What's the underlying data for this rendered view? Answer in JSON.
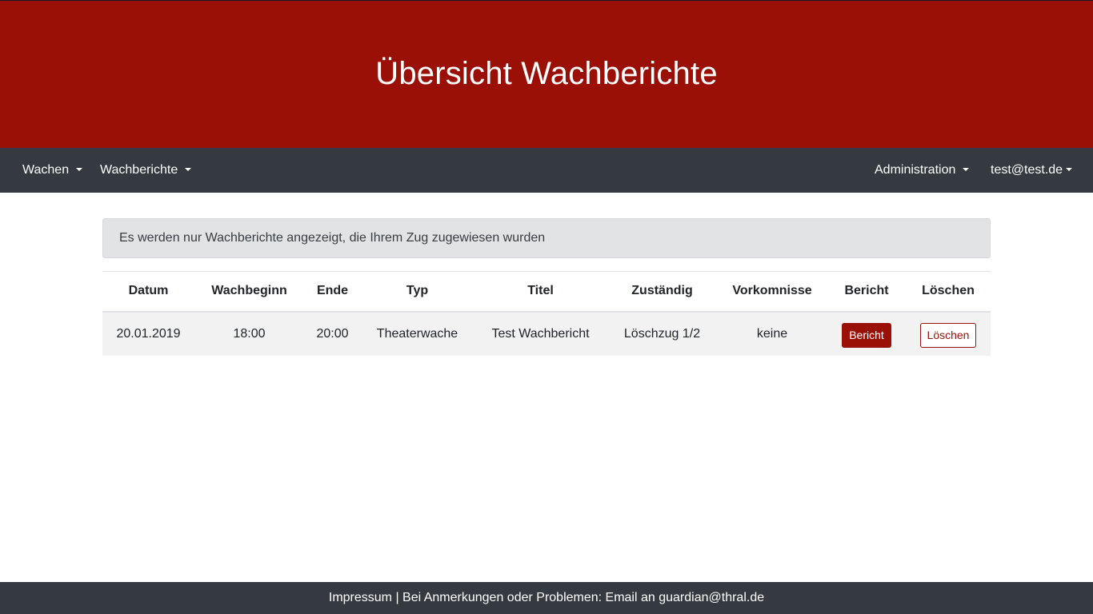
{
  "header": {
    "title": "Übersicht Wachberichte"
  },
  "navbar": {
    "left": [
      {
        "label": "Wachen"
      },
      {
        "label": "Wachberichte"
      }
    ],
    "right": [
      {
        "label": "Administration"
      },
      {
        "label": "test@test.de"
      }
    ]
  },
  "alert": {
    "text": "Es werden nur Wachberichte angezeigt, die Ihrem Zug zugewiesen wurden"
  },
  "table": {
    "headers": [
      "Datum",
      "Wachbeginn",
      "Ende",
      "Typ",
      "Titel",
      "Zuständig",
      "Vorkomnisse",
      "Bericht",
      "Löschen"
    ],
    "rows": [
      {
        "datum": "20.01.2019",
        "wachbeginn": "18:00",
        "ende": "20:00",
        "typ": "Theaterwache",
        "titel": "Test Wachbericht",
        "zustaendig": "Löschzug 1/2",
        "vorkomnisse": "keine",
        "bericht_label": "Bericht",
        "loeschen_label": "Löschen"
      }
    ]
  },
  "footer": {
    "text": "Impressum | Bei Anmerkungen oder Problemen: Email an guardian@thral.de"
  },
  "colors": {
    "brand": "#9b1006",
    "navbar": "#343a40",
    "alert_bg": "#e2e3e5",
    "row_bg": "#f2f2f2"
  }
}
